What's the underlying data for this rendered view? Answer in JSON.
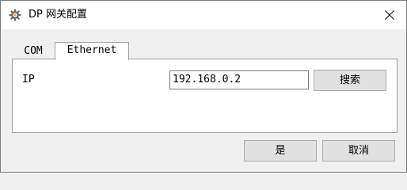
{
  "window": {
    "title": "DP 网关配置",
    "title_icon": "gear-icon",
    "close_icon": "close-icon"
  },
  "tabs": [
    {
      "label": "COM",
      "selected": false
    },
    {
      "label": "Ethernet",
      "selected": true
    }
  ],
  "ethernet": {
    "ip_label": "IP",
    "ip_value": "192.168.0.2",
    "search_label": "搜索"
  },
  "footer": {
    "yes_label": "是",
    "cancel_label": "取消"
  },
  "colors": {
    "titlebar_bg": "#ffffff",
    "window_bg": "#f0f0f0",
    "panel_bg": "#ffffff",
    "button_bg": "#e1e1e1",
    "border": "#a0a0a0"
  }
}
